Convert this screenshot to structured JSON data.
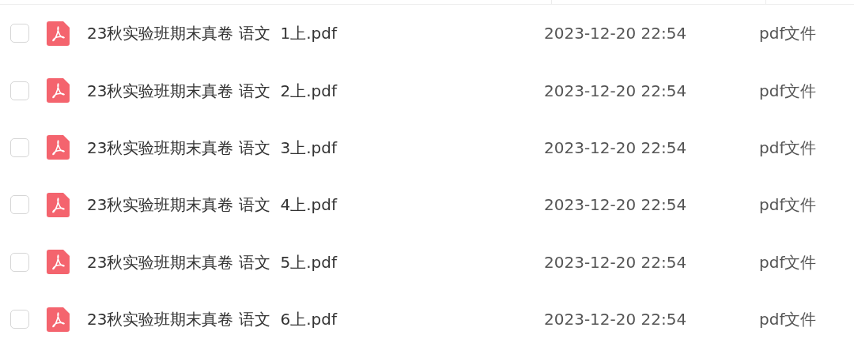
{
  "files": [
    {
      "name": "23秋实验班期末真卷 语文  1上.pdf",
      "modified": "2023-12-20 22:54",
      "type": "pdf文件",
      "checked": false
    },
    {
      "name": "23秋实验班期末真卷 语文  2上.pdf",
      "modified": "2023-12-20 22:54",
      "type": "pdf文件",
      "checked": false
    },
    {
      "name": "23秋实验班期末真卷 语文  3上.pdf",
      "modified": "2023-12-20 22:54",
      "type": "pdf文件",
      "checked": false
    },
    {
      "name": "23秋实验班期末真卷 语文  4上.pdf",
      "modified": "2023-12-20 22:54",
      "type": "pdf文件",
      "checked": false
    },
    {
      "name": "23秋实验班期末真卷 语文  5上.pdf",
      "modified": "2023-12-20 22:54",
      "type": "pdf文件",
      "checked": false
    },
    {
      "name": "23秋实验班期末真卷 语文  6上.pdf",
      "modified": "2023-12-20 22:54",
      "type": "pdf文件",
      "checked": false
    }
  ]
}
